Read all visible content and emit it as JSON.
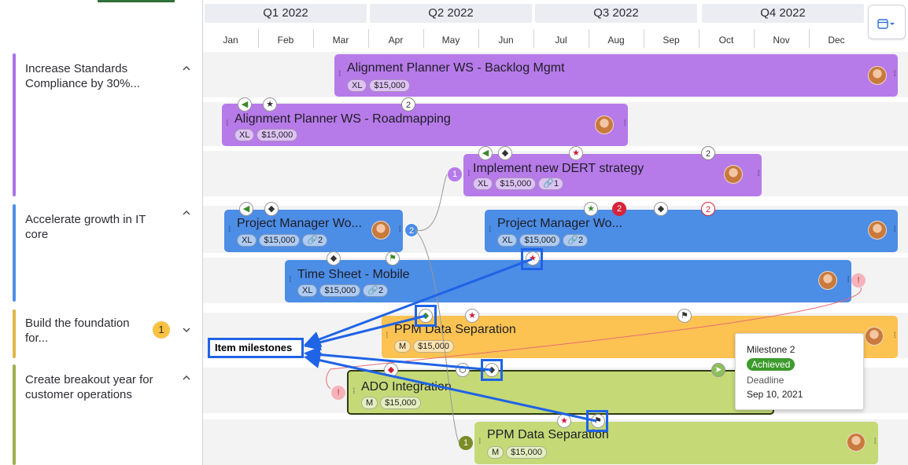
{
  "quarters": [
    "Q1 2022",
    "Q2 2022",
    "Q3 2022",
    "Q4 2022"
  ],
  "months": [
    "Jan",
    "Feb",
    "Mar",
    "Apr",
    "May",
    "Jun",
    "Jul",
    "Aug",
    "Sep",
    "Oct",
    "Nov",
    "Dec"
  ],
  "goals": [
    {
      "title": "Increase Standards Compliance by 30%...",
      "color": "#a874e6",
      "expanded": true
    },
    {
      "title": "Accelerate growth in IT core",
      "color": "#4f8fe8",
      "expanded": true
    },
    {
      "title": "Build the foundation for...",
      "color": "#e0b64a",
      "expanded": false,
      "count": "1"
    },
    {
      "title": "Create breakout year for customer operations",
      "color": "#9fb04e",
      "expanded": true
    }
  ],
  "items": [
    {
      "title": "Alignment Planner WS - Backlog Mgmt",
      "size": "XL",
      "cost": "$15,000"
    },
    {
      "title": "Alignment Planner WS - Roadmapping",
      "size": "XL",
      "cost": "$15,000",
      "badge": "2"
    },
    {
      "title": "Implement new DERT strategy",
      "size": "XL",
      "cost": "$15,000",
      "links": "1",
      "badge": "2",
      "dep": "1"
    },
    {
      "title": "Project Manager Wo...",
      "size": "XL",
      "cost": "$15,000",
      "links": "2",
      "dep": "2"
    },
    {
      "title": "Project Manager Wo...",
      "size": "XL",
      "cost": "$15,000",
      "links": "2",
      "badge_red": "2",
      "badge": "2"
    },
    {
      "title": "Time Sheet - Mobile",
      "size": "XL",
      "cost": "$15,000",
      "links": "2"
    },
    {
      "title": "PPM Data Separation",
      "size": "M",
      "cost": "$15,000"
    },
    {
      "title": "ADO Integration",
      "size": "M",
      "cost": "$15,000"
    },
    {
      "title": "PPM Data Separation",
      "size": "M",
      "cost": "$15,000",
      "dep": "1"
    }
  ],
  "callout_label": "Item milestones",
  "tooltip": {
    "title": "Milestone 2",
    "status": "Achieved",
    "deadline_label": "Deadline",
    "deadline": "Sep 10, 2021"
  },
  "colors": {
    "purple": "#b77ae9",
    "blue": "#4c8de6",
    "yellow": "#fcc352",
    "green": "#c5d977",
    "callout": "#1f63e6"
  }
}
